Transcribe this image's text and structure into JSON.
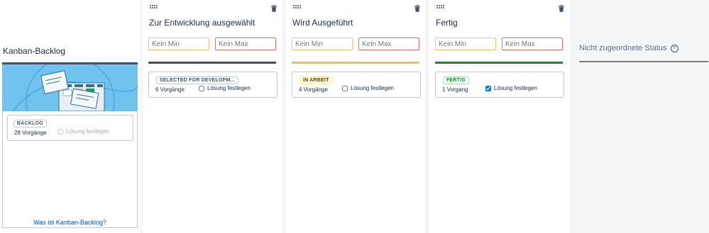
{
  "backlog": {
    "title": "Kanban-Backlog",
    "status_lozenge": "BACKLOG",
    "issue_count": "28 Vorgänge",
    "resolution_label": "Lösung festlegen",
    "resolution_checked": false,
    "resolution_disabled": true,
    "help_link": "Was ist Kanban-Backlog?",
    "illustration_color": "#6fc3ee"
  },
  "columns": [
    {
      "title": "Zur Entwicklung ausgewählt",
      "min_placeholder": "Kein Min",
      "max_placeholder": "Kein Max",
      "bar_color": "#42526e",
      "status_lozenge": "SELECTED FOR DEVELOPM...",
      "lozenge_color": "#42526e",
      "lozenge_border": "#c1c7d0",
      "issue_count": "6 Vorgänge",
      "resolution_label": "Lösung festlegen",
      "resolution_checked": false
    },
    {
      "title": "Wird Ausgeführt",
      "min_placeholder": "Kein Min",
      "max_placeholder": "Kein Max",
      "bar_color": "#f6c342",
      "status_lozenge": "IN ARBEIT",
      "lozenge_color": "#594300",
      "lozenge_border": "#ffe9a8",
      "issue_count": "4 Vorgänge",
      "resolution_label": "Lösung festlegen",
      "resolution_checked": false
    },
    {
      "title": "Fertig",
      "min_placeholder": "Kein Min",
      "max_placeholder": "Kein Max",
      "bar_color": "#14892c",
      "status_lozenge": "FERTIG",
      "lozenge_color": "#14892c",
      "lozenge_border": "#b2d8b9",
      "issue_count": "1 Vorgang",
      "resolution_label": "Lösung festlegen",
      "resolution_checked": true
    }
  ],
  "unmapped": {
    "title": "Nicht zugeordnete Status",
    "help_icon": "question-circle-icon",
    "bar_color": "#7a7a7a"
  }
}
